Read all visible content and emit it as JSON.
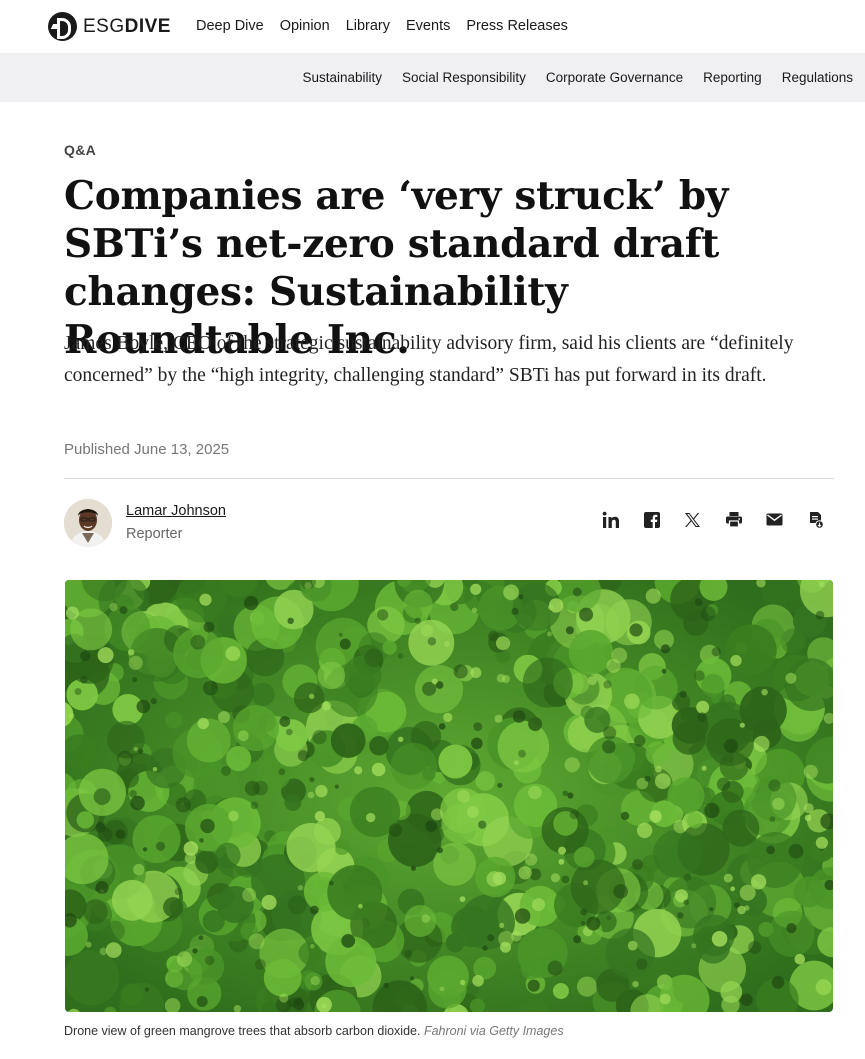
{
  "site": {
    "logo_light": "ESG",
    "logo_bold": "DIVE"
  },
  "topnav": {
    "items": [
      "Deep Dive",
      "Opinion",
      "Library",
      "Events",
      "Press Releases"
    ]
  },
  "subnav": {
    "items": [
      "Sustainability",
      "Social Responsibility",
      "Corporate Governance",
      "Reporting",
      "Regulations"
    ]
  },
  "article": {
    "kicker": "Q&A",
    "headline": "Companies are ‘very struck’ by SBTi’s net-zero standard draft changes: Sustainability Roundtable Inc.",
    "dek": "James Boyle, CEO of the strategic sustainability advisory firm, said his clients are “definitely concerned” by the “high integrity, challenging standard” SBTi has put forward in its draft.",
    "published": "Published June 13, 2025",
    "author_name": "Lamar Johnson",
    "author_role": "Reporter",
    "caption": "Drone view of green mangrove trees that absorb carbon dioxide.",
    "caption_credit": "Fahroni via Getty Images"
  },
  "share_icons": [
    "linkedin-icon",
    "facebook-icon",
    "x-icon",
    "print-icon",
    "email-icon",
    "save-document-icon"
  ],
  "colors": {
    "subnav_bg": "#f0f0f2",
    "text": "#1a1a1a",
    "muted": "#777777",
    "forest": "#3f8f28"
  }
}
